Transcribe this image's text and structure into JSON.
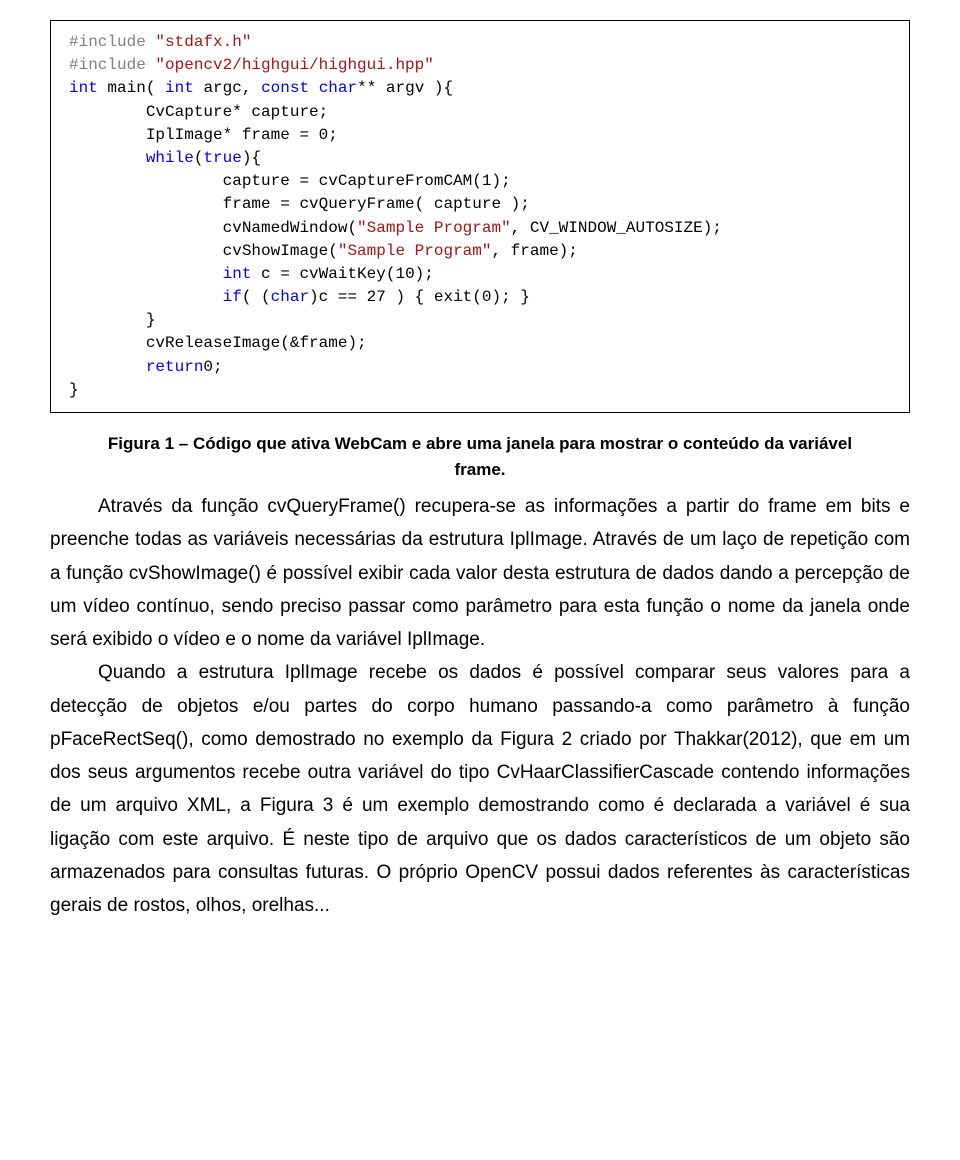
{
  "code": {
    "l01a": "#include",
    "l01b": " \"stdafx.h\"",
    "l02a": "#include",
    "l02b": " \"opencv2/highgui/highgui.hpp\"",
    "l03a": "int",
    "l03b": " main( ",
    "l03c": "int",
    "l03d": " argc, ",
    "l03e": "const",
    "l03f": " ",
    "l03g": "char",
    "l03h": "** argv ){",
    "l04": "        CvCapture* capture;",
    "l05": "        IplImage* frame = 0;",
    "l06a": "        ",
    "l06b": "while",
    "l06c": "(",
    "l06d": "true",
    "l06e": "){",
    "l07": "                capture = cvCaptureFromCAM(1);",
    "l08": "                frame = cvQueryFrame( capture );",
    "l09a": "                cvNamedWindow(",
    "l09b": "\"Sample Program\"",
    "l09c": ", CV_WINDOW_AUTOSIZE);",
    "l10a": "                cvShowImage(",
    "l10b": "\"Sample Program\"",
    "l10c": ", frame);",
    "l11a": "                ",
    "l11b": "int",
    "l11c": " c = cvWaitKey(10);",
    "l12a": "                ",
    "l12b": "if",
    "l12c": "( (",
    "l12d": "char",
    "l12e": ")c == 27 ) { exit(0); }",
    "l13": "        }",
    "l14": "        cvReleaseImage(&frame);",
    "l15a": "        ",
    "l15b": "return",
    "l15c": "0;",
    "l16": "}"
  },
  "caption": {
    "line1": "Figura 1 – Código que ativa WebCam e abre uma janela para mostrar o conteúdo da variável",
    "line2": "frame."
  },
  "para1": "Através da função cvQueryFrame() recupera-se as informações a partir do frame em bits e preenche todas as variáveis necessárias da estrutura IplImage. Através de um laço de repetição com a função cvShowImage() é possível exibir cada valor desta estrutura de dados dando a percepção de um vídeo contínuo, sendo preciso passar como parâmetro para esta função o nome da janela onde será exibido o vídeo e o nome da variável IplImage.",
  "para2": "Quando a estrutura IplImage recebe os dados é possível comparar seus valores para a detecção de objetos e/ou partes do corpo humano passando-a como parâmetro à função pFaceRectSeq(), como demostrado no exemplo da Figura 2 criado por Thakkar(2012), que em um dos seus argumentos recebe outra variável do tipo CvHaarClassifierCascade contendo informações de um arquivo XML, a Figura 3 é um exemplo demostrando como é declarada a variável é sua ligação com este arquivo. É neste tipo de arquivo que os dados característicos de um objeto são armazenados para consultas futuras. O próprio OpenCV possui dados referentes às características gerais de rostos, olhos, orelhas..."
}
